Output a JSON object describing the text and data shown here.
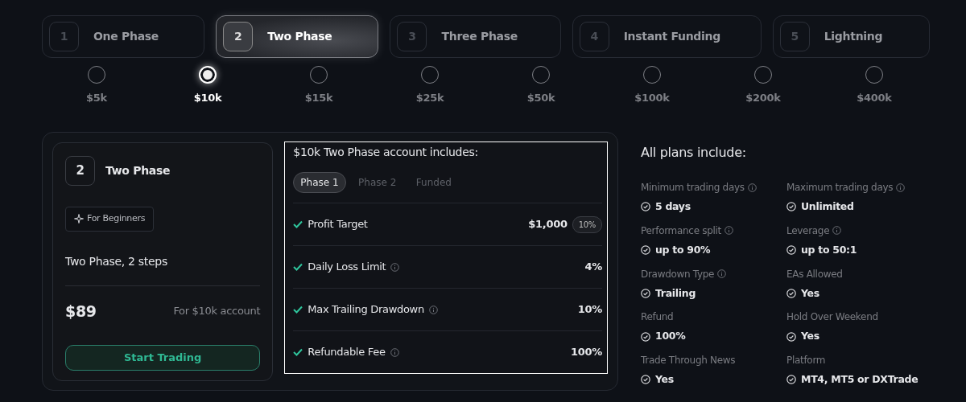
{
  "plan_tabs": [
    {
      "number": "1",
      "label": "One Phase",
      "selected": false
    },
    {
      "number": "2",
      "label": "Two Phase",
      "selected": true
    },
    {
      "number": "3",
      "label": "Three Phase",
      "selected": false
    },
    {
      "number": "4",
      "label": "Instant Funding",
      "selected": false
    },
    {
      "number": "5",
      "label": "Lightning",
      "selected": false
    }
  ],
  "account_sizes": [
    {
      "label": "$5k",
      "selected": false
    },
    {
      "label": "$10k",
      "selected": true
    },
    {
      "label": "$15k",
      "selected": false
    },
    {
      "label": "$25k",
      "selected": false
    },
    {
      "label": "$50k",
      "selected": false
    },
    {
      "label": "$100k",
      "selected": false
    },
    {
      "label": "$200k",
      "selected": false
    },
    {
      "label": "$400k",
      "selected": false
    }
  ],
  "plan_card": {
    "number": "2",
    "title": "Two Phase",
    "tag": "For Beginners",
    "subtitle": "Two Phase, 2 steps",
    "price": "$89",
    "price_note": "For $10k account",
    "button": "Start Trading"
  },
  "includes": {
    "title": "$10k Two Phase account includes:",
    "phase_tabs": [
      {
        "label": "Phase 1",
        "selected": true
      },
      {
        "label": "Phase 2",
        "selected": false
      },
      {
        "label": "Funded",
        "selected": false
      }
    ],
    "rows": [
      {
        "label": "Profit Target",
        "info": false,
        "value": "$1,000",
        "badge": "10%"
      },
      {
        "label": "Daily Loss Limit",
        "info": true,
        "value": "4%"
      },
      {
        "label": "Max Trailing Drawdown",
        "info": true,
        "value": "10%"
      },
      {
        "label": "Refundable Fee",
        "info": true,
        "value": "100%"
      }
    ]
  },
  "all_plans": {
    "title": "All plans include:",
    "features": [
      {
        "label": "Minimum trading days",
        "info": true,
        "value": "5 days"
      },
      {
        "label": "Maximum trading days",
        "info": true,
        "value": "Unlimited"
      },
      {
        "label": "Performance split",
        "info": true,
        "value": "up to 90%"
      },
      {
        "label": "Leverage",
        "info": true,
        "value": "up to 50:1"
      },
      {
        "label": "Drawdown Type",
        "info": true,
        "value": "Trailing"
      },
      {
        "label": "EAs Allowed",
        "info": false,
        "value": "Yes"
      },
      {
        "label": "Refund",
        "info": false,
        "value": "100%"
      },
      {
        "label": "Hold Over Weekend",
        "info": false,
        "value": "Yes"
      },
      {
        "label": "Trade Through News",
        "info": false,
        "value": "Yes"
      },
      {
        "label": "Platform",
        "info": false,
        "value": "MT4, MT5 or DXTrade"
      }
    ]
  }
}
